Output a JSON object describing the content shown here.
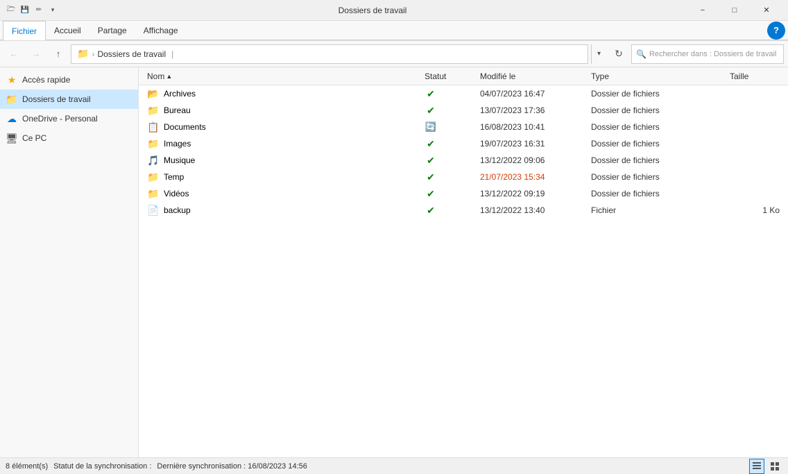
{
  "titleBar": {
    "title": "Dossiers de travail",
    "minimize": "−",
    "maximize": "□",
    "close": "✕"
  },
  "ribbon": {
    "tabs": [
      {
        "id": "fichier",
        "label": "Fichier",
        "active": true
      },
      {
        "id": "accueil",
        "label": "Accueil",
        "active": false
      },
      {
        "id": "partage",
        "label": "Partage",
        "active": false
      },
      {
        "id": "affichage",
        "label": "Affichage",
        "active": false
      }
    ],
    "helpLabel": "?"
  },
  "addressBar": {
    "pathLabel": "Dossiers de travail",
    "searchPlaceholder": "Rechercher dans : Dossiers de travail"
  },
  "sidebar": {
    "items": [
      {
        "id": "acces-rapide",
        "label": "Accès rapide",
        "icon": "★"
      },
      {
        "id": "dossiers-de-travail",
        "label": "Dossiers de travail",
        "icon": "📁",
        "active": true
      },
      {
        "id": "onedrive",
        "label": "OneDrive - Personal",
        "icon": "☁"
      },
      {
        "id": "ce-pc",
        "label": "Ce PC",
        "icon": "💻"
      }
    ]
  },
  "fileList": {
    "columns": [
      {
        "id": "nom",
        "label": "Nom",
        "sort": "▲"
      },
      {
        "id": "statut",
        "label": "Statut"
      },
      {
        "id": "modifie",
        "label": "Modifié le"
      },
      {
        "id": "type",
        "label": "Type"
      },
      {
        "id": "taille",
        "label": "Taille"
      }
    ],
    "rows": [
      {
        "id": "archives",
        "name": "Archives",
        "icon": "folder",
        "iconColor": "folder-light",
        "status": "sync",
        "statusType": "green",
        "modified": "04/07/2023 16:47",
        "modifiedColor": "",
        "type": "Dossier de fichiers",
        "size": ""
      },
      {
        "id": "bureau",
        "name": "Bureau",
        "icon": "folder",
        "iconColor": "folder-blue",
        "status": "sync",
        "statusType": "green",
        "modified": "13/07/2023 17:36",
        "modifiedColor": "",
        "type": "Dossier de fichiers",
        "size": ""
      },
      {
        "id": "documents",
        "name": "Documents",
        "icon": "folder-doc",
        "iconColor": "folder-gray",
        "status": "syncing",
        "statusType": "blue",
        "modified": "16/08/2023 10:41",
        "modifiedColor": "",
        "type": "Dossier de fichiers",
        "size": ""
      },
      {
        "id": "images",
        "name": "Images",
        "icon": "folder",
        "iconColor": "folder-gray",
        "status": "sync",
        "statusType": "green",
        "modified": "19/07/2023 16:31",
        "modifiedColor": "",
        "type": "Dossier de fichiers",
        "size": ""
      },
      {
        "id": "musique",
        "name": "Musique",
        "icon": "music",
        "iconColor": "music-icon",
        "status": "sync",
        "statusType": "green",
        "modified": "13/12/2022 09:06",
        "modifiedColor": "",
        "type": "Dossier de fichiers",
        "size": ""
      },
      {
        "id": "temp",
        "name": "Temp",
        "icon": "folder",
        "iconColor": "folder-yellow",
        "status": "sync",
        "statusType": "green",
        "modified": "21/07/2023 15:34",
        "modifiedColor": "date-orange",
        "type": "Dossier de fichiers",
        "size": ""
      },
      {
        "id": "videos",
        "name": "Vidéos",
        "icon": "folder-vid",
        "iconColor": "folder-gray",
        "status": "sync",
        "statusType": "green",
        "modified": "13/12/2022 09:19",
        "modifiedColor": "",
        "type": "Dossier de fichiers",
        "size": ""
      },
      {
        "id": "backup",
        "name": "backup",
        "icon": "file",
        "iconColor": "file-white",
        "status": "sync",
        "statusType": "green",
        "modified": "13/12/2022 13:40",
        "modifiedColor": "",
        "type": "Fichier",
        "size": "1 Ko"
      }
    ]
  },
  "statusBar": {
    "itemCount": "8 élément(s)",
    "syncStatus": "Statut de la synchronisation :",
    "lastSync": "Dernière synchronisation : 16/08/2023 14:56"
  }
}
